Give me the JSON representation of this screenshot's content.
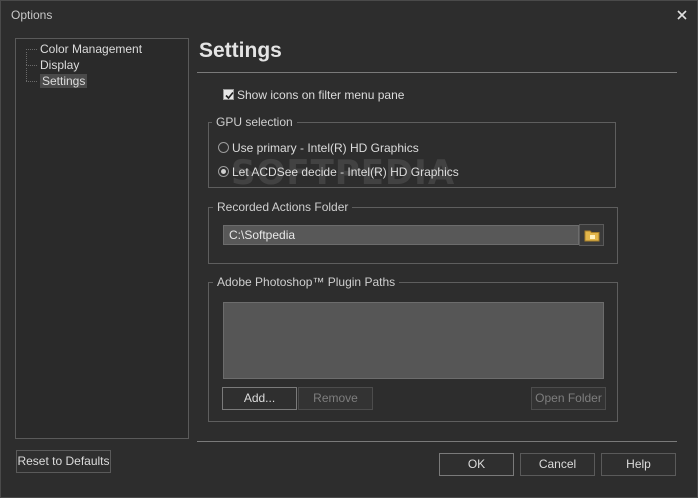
{
  "window": {
    "title": "Options",
    "close_symbol": "×",
    "close_icon": "close-icon"
  },
  "tree": {
    "items": [
      {
        "label": "Color Management",
        "selected": false
      },
      {
        "label": "Display",
        "selected": false
      },
      {
        "label": "Settings",
        "selected": true
      }
    ]
  },
  "settings": {
    "title": "Settings",
    "show_icons": {
      "label": "Show icons on filter menu pane",
      "checked": true
    },
    "gpu": {
      "title": "GPU selection",
      "options": [
        {
          "label": "Use primary - Intel(R) HD Graphics",
          "selected": false
        },
        {
          "label": "Let ACDSee decide - Intel(R) HD Graphics",
          "selected": true
        }
      ]
    },
    "recorded_actions": {
      "title": "Recorded Actions Folder",
      "path_value": "C:\\Softpedia",
      "browse_icon": "folder-icon"
    },
    "plugin_paths": {
      "title": "Adobe Photoshop™ Plugin Paths",
      "items": [],
      "add_label": "Add...",
      "remove_label": "Remove",
      "open_folder_label": "Open Folder"
    }
  },
  "footer": {
    "reset_label": "Reset to Defaults",
    "ok_label": "OK",
    "cancel_label": "Cancel",
    "help_label": "Help"
  },
  "watermark": "SOFTPEDIA",
  "colors": {
    "background": "#2d2d2d",
    "input_bg": "#585858",
    "border": "#5e5e5e",
    "text": "#dcdcdc",
    "disabled_text": "#7e7e7e"
  }
}
